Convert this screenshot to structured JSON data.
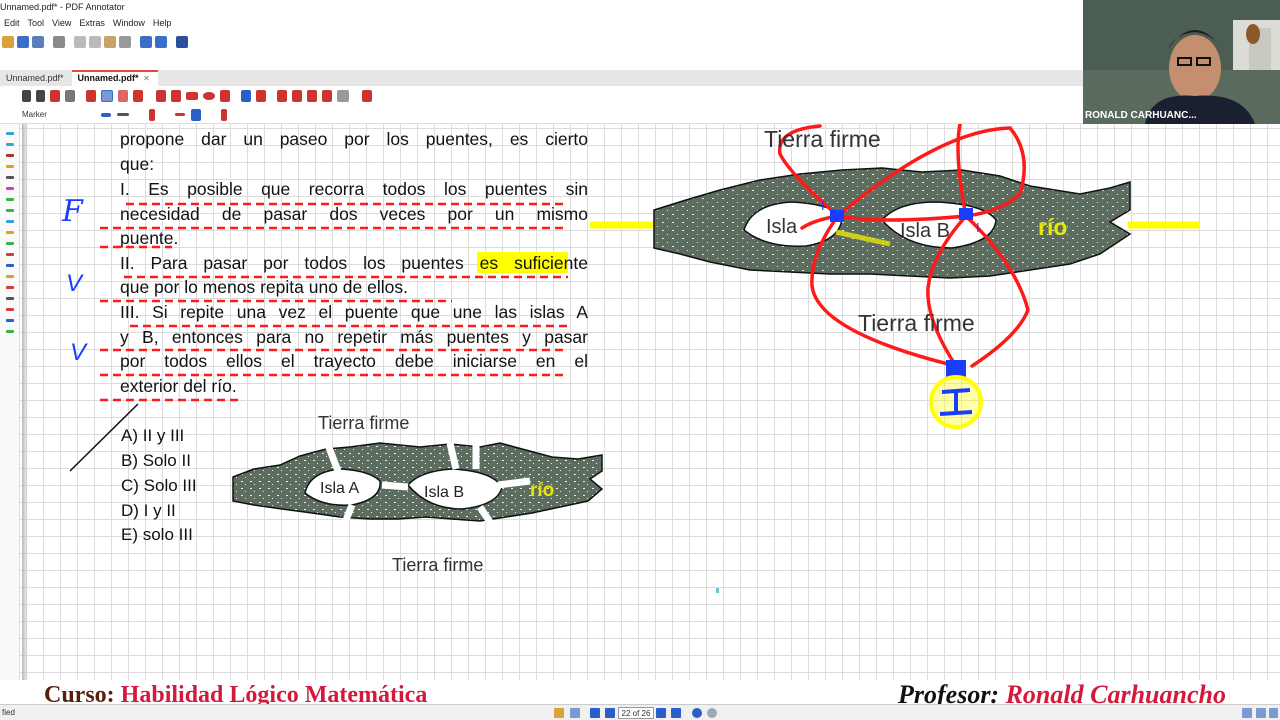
{
  "window": {
    "title": "Unnamed.pdf* - PDF Annotator",
    "menu": [
      "Edit",
      "Tool",
      "View",
      "Extras",
      "Window",
      "Help"
    ]
  },
  "tabs": [
    {
      "label": "Unnamed.pdf*",
      "active": false
    },
    {
      "label": "Unnamed.pdf*",
      "active": true
    }
  ],
  "toolbar": {
    "tool_label": "Marker"
  },
  "webcam": {
    "name": "RONALD CARHUANC..."
  },
  "question": {
    "lines": [
      "propone dar un paseo por los puentes, es cierto",
      "que:",
      "I. Es posible que recorra todos los puentes sin",
      "necesidad de pasar dos veces por un mismo",
      "puente.",
      "II. Para pasar por todos los puentes es suficiente",
      "que por lo menos repita uno de ellos.",
      "III. Si repite una vez el puente que une las islas A",
      "y B, entonces para no repetir más puentes y pasar",
      "por todos ellos el trayecto debe iniciarse en el",
      "exterior del río."
    ],
    "options": [
      "A) II y III",
      "B) Solo II",
      "C) Solo III",
      "D) I y II",
      "E) solo III"
    ],
    "marks": [
      "F",
      "V",
      "V"
    ]
  },
  "map_small": {
    "top_label": "Tierra firme",
    "bottom_label": "Tierra firme",
    "island_a": "Isla A",
    "island_b": "Isla B",
    "river": "río"
  },
  "map_large": {
    "top_label": "Tierra firme",
    "bottom_label": "Tierra firme",
    "island_a": "Isla",
    "island_b": "Isla B",
    "river": "río",
    "marker_label": "I"
  },
  "footer": {
    "course_prefix": "Curso:",
    "course_name": "Habilidad Lógico Matemática",
    "professor_prefix": "Profesor:",
    "professor_name": "Ronald Carhuancho"
  },
  "statusbar": {
    "left": "fied",
    "page": "22 of 26"
  },
  "colors": {
    "annotation_red": "#ff1a1a",
    "highlight_yellow": "#ffff00",
    "pen_blue": "#1a3cff",
    "river_green": "#5d6e60"
  }
}
